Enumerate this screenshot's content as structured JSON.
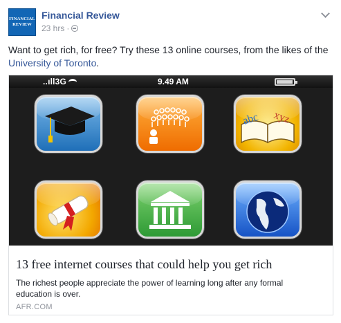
{
  "post": {
    "page_name": "Financial Review",
    "avatar_lines": [
      "FINANCIAL",
      "REVIEW"
    ],
    "timestamp": "23 hrs",
    "separator": "·",
    "audience_icon": "globe-icon",
    "menu_icon": "chevron-down-icon",
    "text_before_link": "Want to get rich, for free? Try these 13 online courses, from the likes of the ",
    "link_text": "University of Toronto",
    "text_after_link": "."
  },
  "card": {
    "status_bar": {
      "carrier": "..ıll3G",
      "time": "9.49 AM"
    },
    "apps": [
      {
        "icon": "graduation-cap-icon"
      },
      {
        "icon": "crowd-icon"
      },
      {
        "icon": "abc-xyz-book-icon"
      },
      {
        "icon": "diploma-icon"
      },
      {
        "icon": "museum-icon"
      },
      {
        "icon": "globe-icon"
      }
    ],
    "title": "13 free internet courses that could help you get rich",
    "description": "The richest people appreciate the power of learning long after any formal education is over.",
    "domain": "AFR.COM"
  },
  "colors": {
    "link": "#365899",
    "secondary_text": "#90949c",
    "avatar_bg": "#1266b5"
  }
}
